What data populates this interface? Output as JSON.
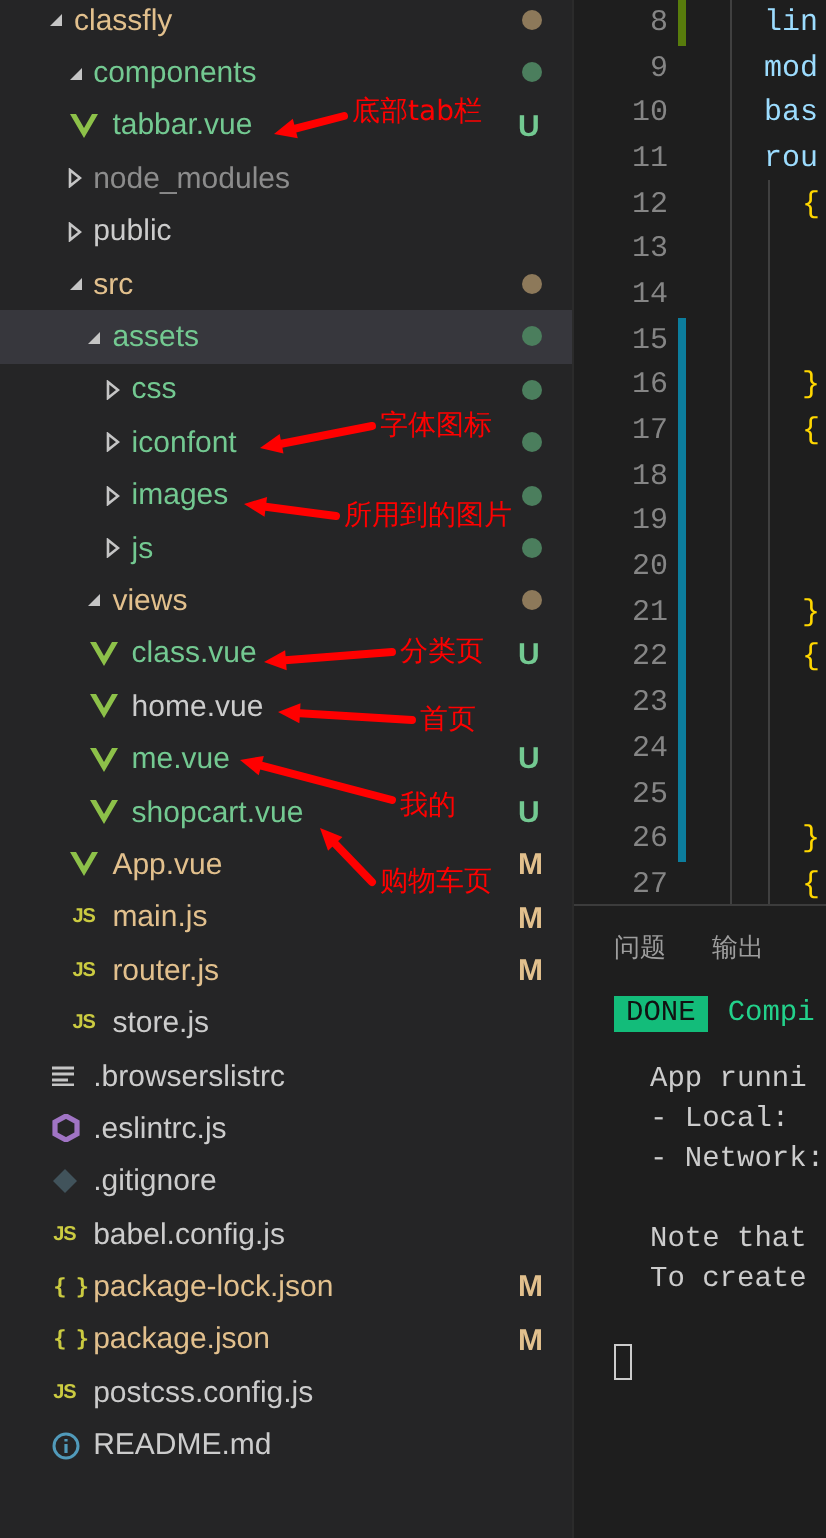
{
  "explorer": {
    "tree": [
      {
        "name": "classfly",
        "kind": "folder",
        "expanded": true,
        "color": "#e2c08d",
        "dot": true,
        "selected": false,
        "children": [
          {
            "name": "components",
            "kind": "folder",
            "expanded": true,
            "color": "#73c991",
            "dot": true,
            "selected": false,
            "children": [
              {
                "name": "tabbar.vue",
                "kind": "vue",
                "color": "#73c991",
                "badge": "U",
                "selected": false
              }
            ]
          },
          {
            "name": "node_modules",
            "kind": "folder",
            "expanded": false,
            "color": "#8c8c8c",
            "selected": false
          },
          {
            "name": "public",
            "kind": "folder",
            "expanded": false,
            "color": "#cccccc",
            "selected": false
          },
          {
            "name": "src",
            "kind": "folder",
            "expanded": true,
            "color": "#e2c08d",
            "dot": true,
            "selected": false,
            "children": [
              {
                "name": "assets",
                "kind": "folder",
                "expanded": true,
                "color": "#73c991",
                "dot": true,
                "selected": true,
                "children": [
                  {
                    "name": "css",
                    "kind": "folder",
                    "expanded": false,
                    "color": "#73c991",
                    "dot": true,
                    "selected": false
                  },
                  {
                    "name": "iconfont",
                    "kind": "folder",
                    "expanded": false,
                    "color": "#73c991",
                    "dot": true,
                    "selected": false
                  },
                  {
                    "name": "images",
                    "kind": "folder",
                    "expanded": false,
                    "color": "#73c991",
                    "dot": true,
                    "selected": false
                  },
                  {
                    "name": "js",
                    "kind": "folder",
                    "expanded": false,
                    "color": "#73c991",
                    "dot": true,
                    "selected": false
                  }
                ]
              },
              {
                "name": "views",
                "kind": "folder",
                "expanded": true,
                "color": "#e2c08d",
                "dot": true,
                "selected": false,
                "children": [
                  {
                    "name": "class.vue",
                    "kind": "vue",
                    "color": "#73c991",
                    "badge": "U",
                    "selected": false
                  },
                  {
                    "name": "home.vue",
                    "kind": "vue",
                    "color": "#cccccc",
                    "selected": false
                  },
                  {
                    "name": "me.vue",
                    "kind": "vue",
                    "color": "#73c991",
                    "badge": "U",
                    "selected": false
                  },
                  {
                    "name": "shopcart.vue",
                    "kind": "vue",
                    "color": "#73c991",
                    "badge": "U",
                    "selected": false
                  }
                ]
              },
              {
                "name": "App.vue",
                "kind": "vue",
                "color": "#e2c08d",
                "badge": "M",
                "selected": false
              },
              {
                "name": "main.js",
                "kind": "js",
                "icon_label": "JS",
                "color": "#e2c08d",
                "badge": "M",
                "selected": false
              },
              {
                "name": "router.js",
                "kind": "js",
                "icon_label": "JS",
                "color": "#e2c08d",
                "badge": "M",
                "selected": false
              },
              {
                "name": "store.js",
                "kind": "js",
                "icon_label": "JS",
                "color": "#cccccc",
                "selected": false
              }
            ]
          },
          {
            "name": ".browserslistrc",
            "kind": "text",
            "color": "#cccccc",
            "selected": false
          },
          {
            "name": ".eslintrc.js",
            "kind": "eslint",
            "color": "#cccccc",
            "selected": false
          },
          {
            "name": ".gitignore",
            "kind": "git",
            "color": "#cccccc",
            "selected": false
          },
          {
            "name": "babel.config.js",
            "kind": "js",
            "icon_label": "JS",
            "color": "#cccccc",
            "selected": false
          },
          {
            "name": "package-lock.json",
            "kind": "json",
            "icon_label": "{ }",
            "color": "#e2c08d",
            "badge": "M",
            "selected": false
          },
          {
            "name": "package.json",
            "kind": "json",
            "icon_label": "{ }",
            "color": "#e2c08d",
            "badge": "M",
            "selected": false
          },
          {
            "name": "postcss.config.js",
            "kind": "js",
            "icon_label": "JS",
            "color": "#cccccc",
            "selected": false
          },
          {
            "name": "README.md",
            "kind": "info",
            "color": "#cccccc",
            "selected": false
          }
        ]
      }
    ]
  },
  "editor": {
    "lines": [
      {
        "number": "8",
        "code": "lin",
        "kind": "key",
        "color": "#587c0c"
      },
      {
        "number": "9",
        "code": "mod",
        "kind": "key"
      },
      {
        "number": "10",
        "code": "bas",
        "kind": "key"
      },
      {
        "number": "11",
        "code": "rou",
        "kind": "key"
      },
      {
        "number": "12",
        "code": "{",
        "kind": "brace"
      },
      {
        "number": "13"
      },
      {
        "number": "14"
      },
      {
        "number": "15",
        "color": "#0c7d9d"
      },
      {
        "number": "16",
        "code": "}",
        "kind": "brace",
        "color": "#0c7d9d"
      },
      {
        "number": "17",
        "code": "{",
        "kind": "brace",
        "color": "#0c7d9d"
      },
      {
        "number": "18",
        "color": "#0c7d9d"
      },
      {
        "number": "19",
        "color": "#0c7d9d"
      },
      {
        "number": "20",
        "color": "#0c7d9d"
      },
      {
        "number": "21",
        "code": "}",
        "kind": "brace",
        "color": "#0c7d9d"
      },
      {
        "number": "22",
        "code": "{",
        "kind": "brace",
        "color": "#0c7d9d"
      },
      {
        "number": "23",
        "color": "#0c7d9d"
      },
      {
        "number": "24",
        "color": "#0c7d9d"
      },
      {
        "number": "25",
        "color": "#0c7d9d"
      },
      {
        "number": "26",
        "code": "}",
        "kind": "brace",
        "color": "#0c7d9d"
      },
      {
        "number": "27",
        "code": "{",
        "kind": "brace"
      }
    ]
  },
  "panel": {
    "tabs": [
      {
        "label": "问题",
        "selected": false
      },
      {
        "label": "输出",
        "selected": false
      }
    ],
    "terminal": {
      "badge": "DONE",
      "status": "Compi",
      "groups": [
        [
          "App runni",
          "- Local:",
          "- Network:"
        ],
        [
          "Note that",
          "To create"
        ]
      ]
    }
  },
  "annotations": [
    {
      "text": "底部tab栏"
    },
    {
      "text": "字体图标"
    },
    {
      "text": "所用到的图片"
    },
    {
      "text": "分类页"
    },
    {
      "text": "首页"
    },
    {
      "text": "我的"
    },
    {
      "text": "购物车页"
    }
  ]
}
